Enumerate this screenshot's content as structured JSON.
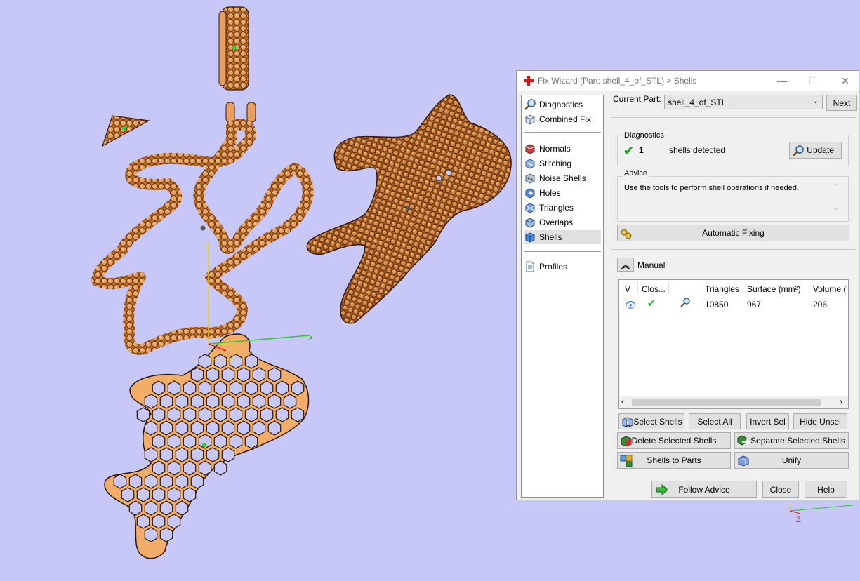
{
  "viewport": {
    "axis_x_label": "X",
    "axis_y_label": "Y",
    "axis_z_label": "Z"
  },
  "dialog": {
    "title": "Fix Wizard (Part: shell_4_of_STL) > Shells",
    "nav": {
      "top": [
        {
          "label": "Diagnostics",
          "icon": "magnifier-icon"
        },
        {
          "label": "Combined Fix",
          "icon": "cube-icon"
        }
      ],
      "middle": [
        {
          "label": "Normals",
          "icon": "normals-icon"
        },
        {
          "label": "Stitching",
          "icon": "stitching-icon"
        },
        {
          "label": "Noise Shells",
          "icon": "noise-shells-icon"
        },
        {
          "label": "Holes",
          "icon": "holes-icon"
        },
        {
          "label": "Triangles",
          "icon": "triangles-icon"
        },
        {
          "label": "Overlaps",
          "icon": "overlaps-icon"
        },
        {
          "label": "Shells",
          "icon": "shells-icon",
          "active": true
        }
      ],
      "bottom": [
        {
          "label": "Profiles",
          "icon": "document-icon"
        }
      ]
    },
    "current_part_label": "Current Part:",
    "current_part_value": "shell_4_of_STL",
    "next_label": "Next",
    "diagnostics": {
      "title": "Diagnostics",
      "count": "1",
      "message": "shells detected",
      "update_label": "Update"
    },
    "advice": {
      "title": "Advice",
      "text": "Use the tools to perform shell operations if needed."
    },
    "automatic_fixing_label": "Automatic Fixing",
    "manual": {
      "title": "Manual",
      "columns": [
        "V",
        "Clos...",
        "",
        "Triangles",
        "Surface (mm²)",
        "Volume ("
      ],
      "rows": [
        {
          "triangles": "10850",
          "surface": "967",
          "volume": "206"
        }
      ]
    },
    "buttons": {
      "select_shells": "Select Shells",
      "select_all": "Select All",
      "invert_sel": "Invert Sel",
      "hide_unsel": "Hide Unsel",
      "delete_selected": "Delete Selected Shells",
      "separate_selected": "Separate Selected Shells",
      "shells_to_parts": "Shells to Parts",
      "unify": "Unify",
      "follow_advice": "Follow Advice",
      "close": "Close",
      "help": "Help"
    },
    "colors": {
      "accent_green": "#2a9d2a",
      "mesh_orange": "#e39a4d",
      "background": "#c8c8f8"
    }
  }
}
